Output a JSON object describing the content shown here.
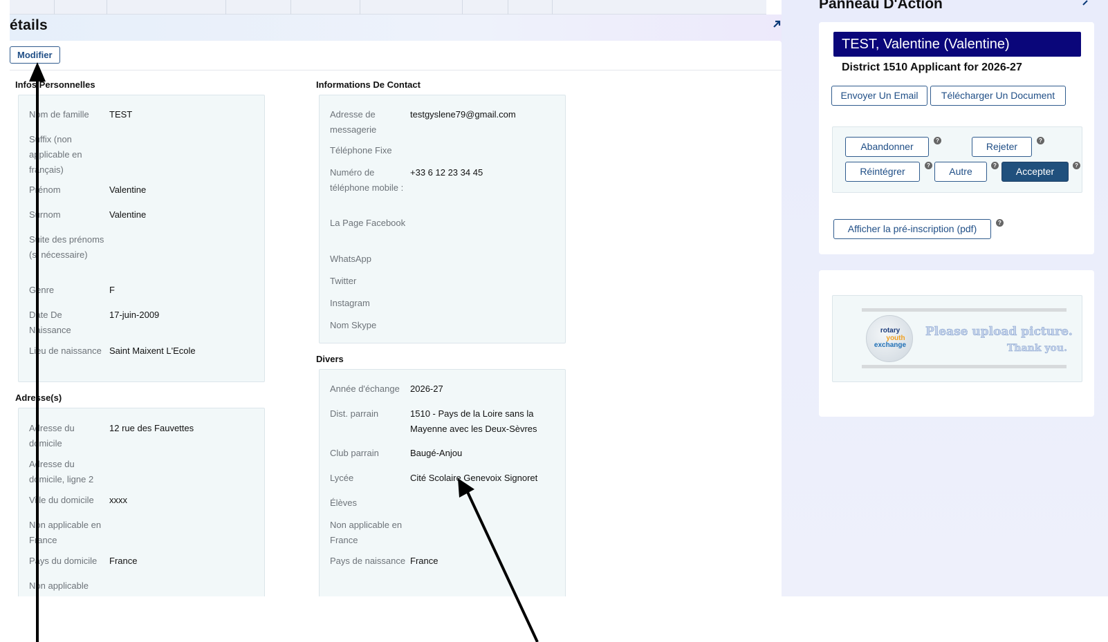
{
  "details": {
    "title": "étails",
    "edit_label": "Modifier"
  },
  "personal": {
    "title": "Infos Personnelles",
    "fields": [
      {
        "label": "Nom de famille",
        "value": "TEST"
      },
      {
        "label": "Suffix (non applicable en français)",
        "value": ""
      },
      {
        "label": "Prénom",
        "value": "Valentine"
      },
      {
        "label": "Surnom",
        "value": "Valentine"
      },
      {
        "label": "Suite des prénoms (si nécessaire)",
        "value": ""
      },
      {
        "label": "Genre",
        "value": "F"
      },
      {
        "label": "Date De Naissance",
        "value": "17-juin-2009"
      },
      {
        "label": "Lieu de naissance",
        "value": "Saint Maixent L'Ecole"
      }
    ]
  },
  "address": {
    "title": "Adresse(s)",
    "fields": [
      {
        "label": "Adresse du domicile",
        "value": "12 rue des Fauvettes"
      },
      {
        "label": "Adresse du domicile, ligne 2",
        "value": ""
      },
      {
        "label": "Ville du domicile",
        "value": "xxxx"
      },
      {
        "label": "Non applicable en France",
        "value": ""
      },
      {
        "label": "Pays du domicile",
        "value": "France"
      },
      {
        "label": "Non applicable",
        "value": ""
      }
    ]
  },
  "contact": {
    "title": "Informations De Contact",
    "fields": [
      {
        "label": "Adresse de messagerie",
        "value": "testgyslene79@gmail.com"
      },
      {
        "label": "Téléphone Fixe",
        "value": ""
      },
      {
        "label": "Numéro de téléphone mobile :",
        "value": "+33 6 12 23 34 45"
      },
      {
        "label": "La Page Facebook",
        "value": ""
      },
      {
        "label": "WhatsApp",
        "value": ""
      },
      {
        "label": "Twitter",
        "value": ""
      },
      {
        "label": "Instagram",
        "value": ""
      },
      {
        "label": "Nom Skype",
        "value": ""
      }
    ]
  },
  "misc": {
    "title": "Divers",
    "fields": [
      {
        "label": "Année d'échange",
        "value": "2026-27"
      },
      {
        "label": "Dist. parrain",
        "value": "1510 - Pays de la Loire sans la Mayenne avec les Deux-Sèvres"
      },
      {
        "label": "Club parrain",
        "value": "Baugé-Anjou"
      },
      {
        "label": "Lycée",
        "value": "Cité Scolaire Genevoix Signoret"
      },
      {
        "label": "Élèves",
        "value": ""
      },
      {
        "label": "Non applicable en France",
        "value": ""
      },
      {
        "label": "Pays de naissance",
        "value": "France"
      }
    ]
  },
  "action_panel": {
    "title": "Panneau D'Action",
    "applicant_name": "TEST, Valentine (Valentine)",
    "applicant_subtitle": "District 1510 Applicant for 2026-27",
    "send_email": "Envoyer Un Email",
    "upload_document": "Télécharger Un Document",
    "abandon": "Abandonner",
    "reject": "Rejeter",
    "reinstate": "Réintégrer",
    "other": "Autre",
    "accept": "Accepter",
    "show_pdf": "Afficher la pré-inscription (pdf)",
    "help_glyph": "?"
  },
  "photo": {
    "logo_line1": "rotary",
    "logo_line2": "youth",
    "logo_line3": "exchange",
    "upload_line1": "Please upload picture.",
    "upload_line2": "Thank you."
  },
  "colors": {
    "banner_bg": "#0a067a",
    "primary_button": "#20507d",
    "link_blue": "#1f4e86"
  }
}
